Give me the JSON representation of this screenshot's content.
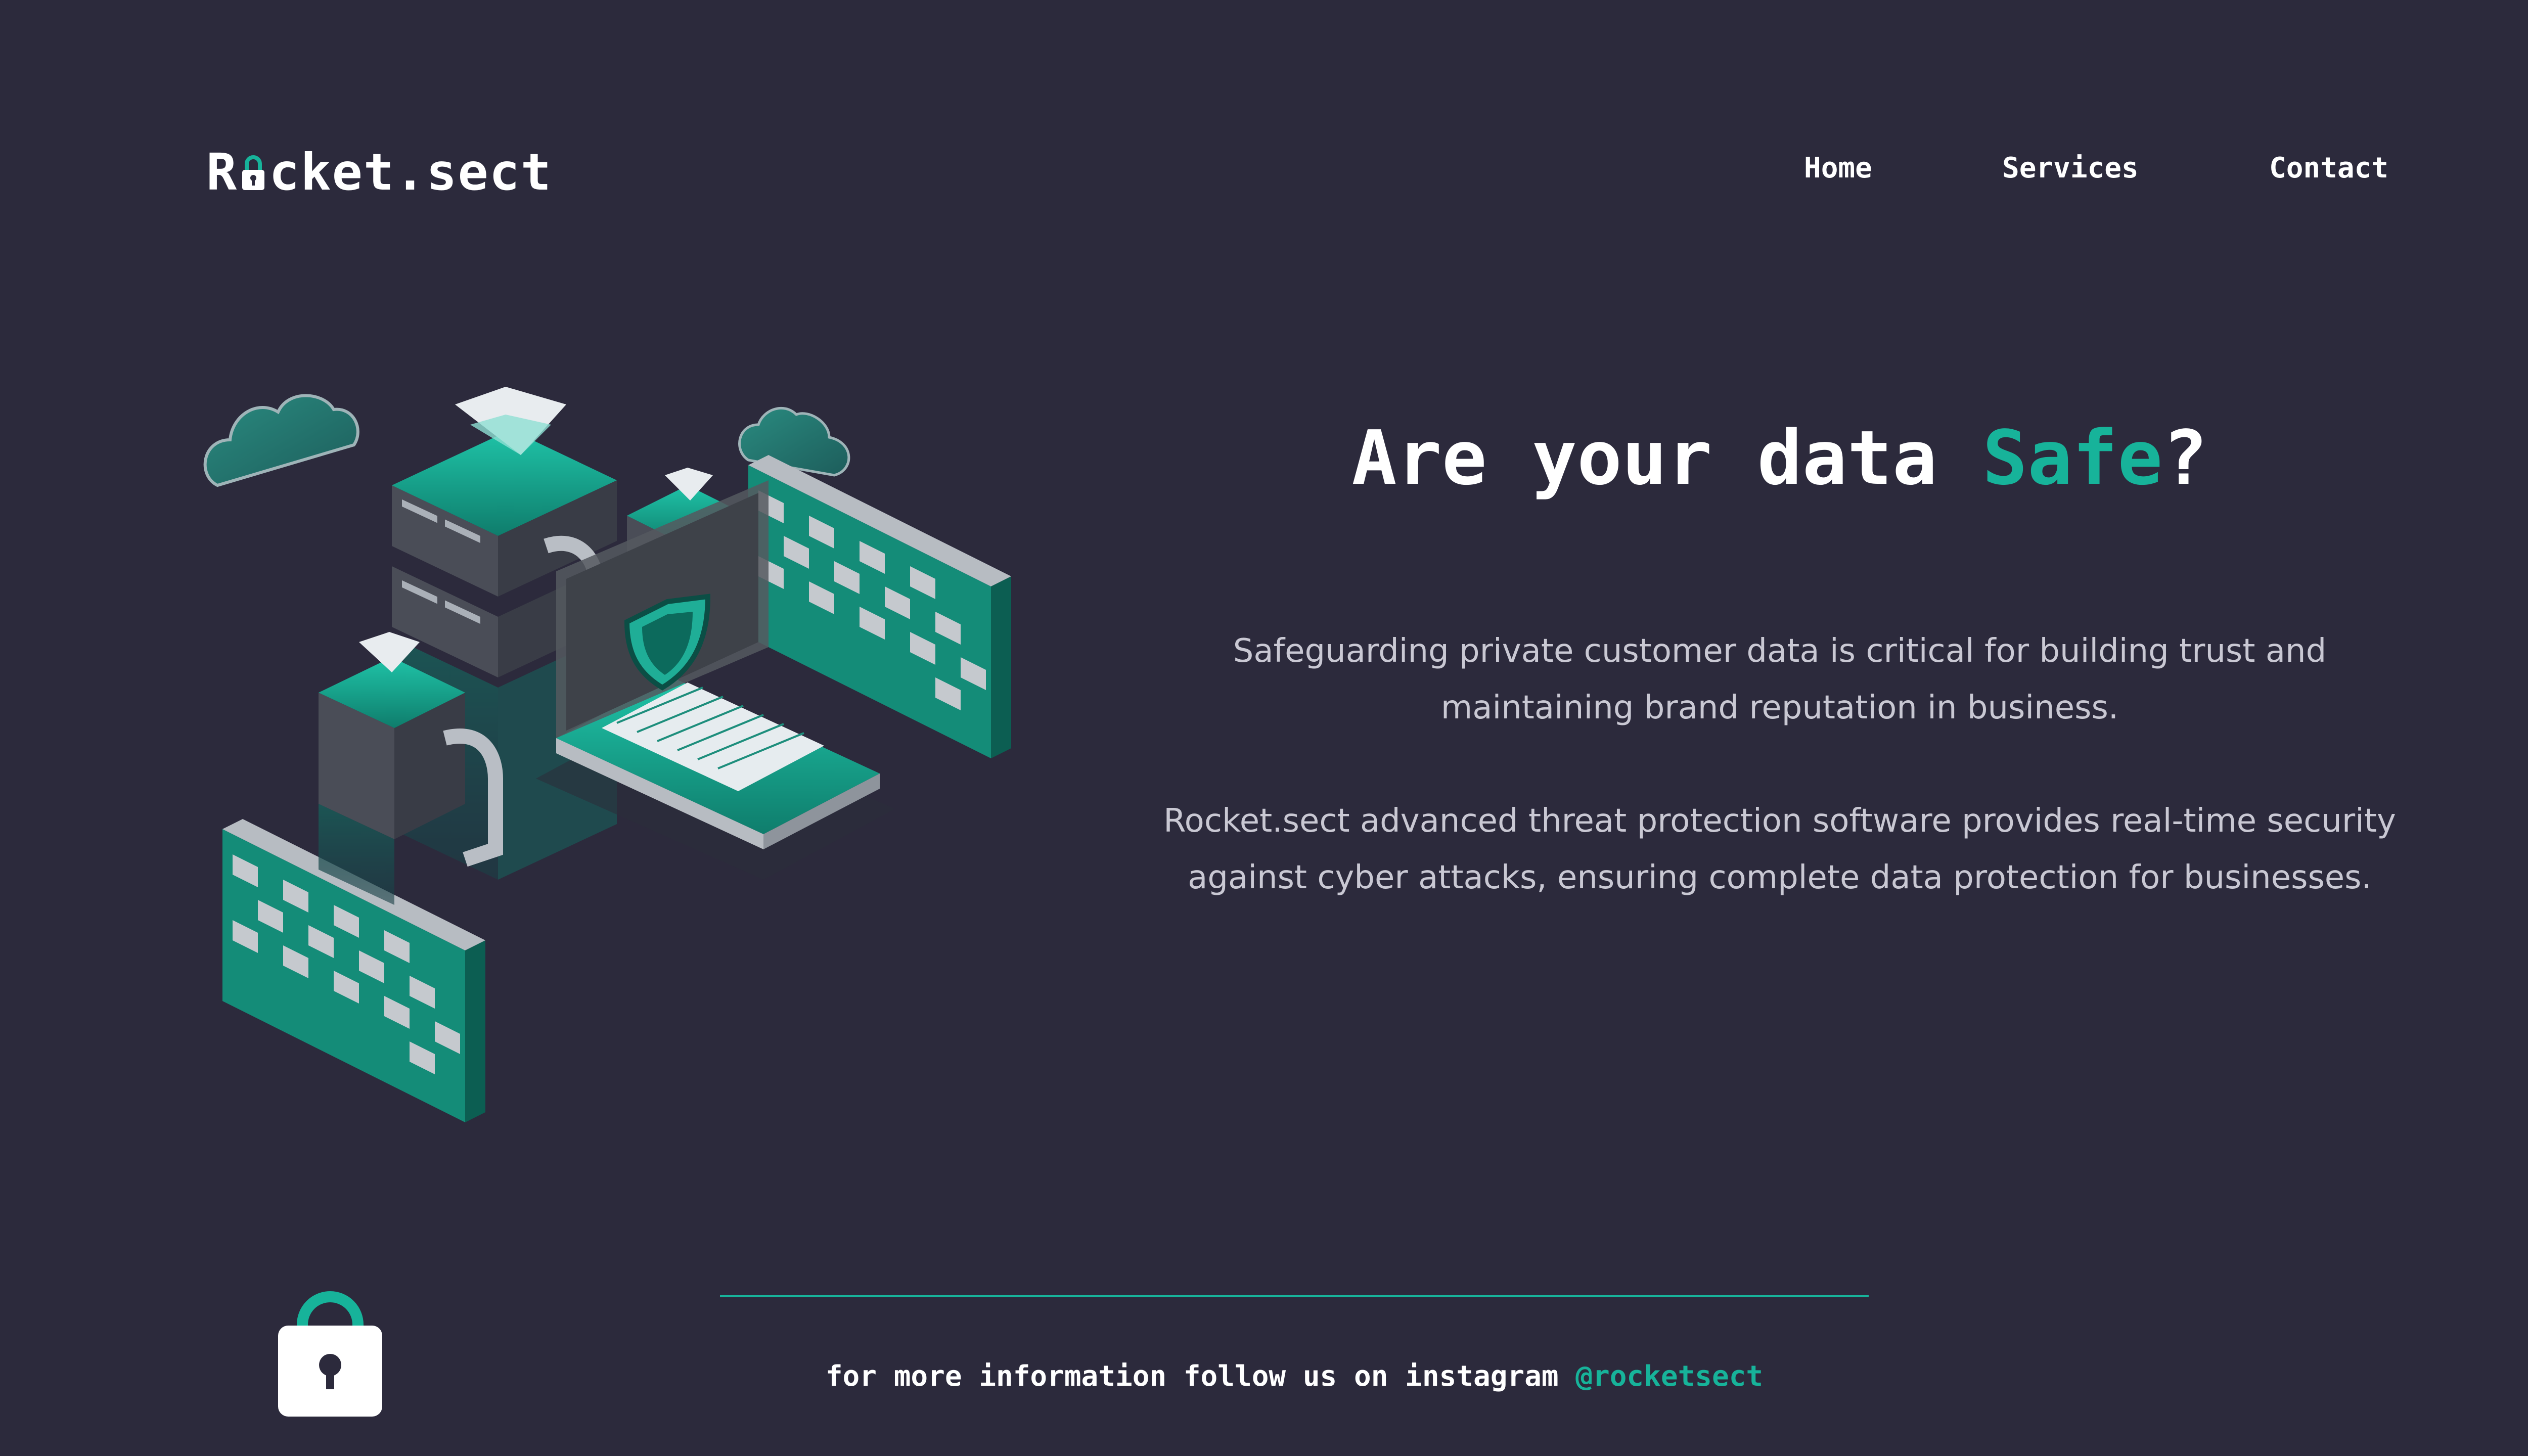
{
  "brand": {
    "name_prefix": "R",
    "name_suffix": "cket.sect",
    "logo_icon": "padlock-icon"
  },
  "nav": {
    "items": [
      {
        "label": "Home"
      },
      {
        "label": "Services"
      },
      {
        "label": "Contact"
      }
    ]
  },
  "hero": {
    "title_before": "Are your data ",
    "title_accent": "Safe",
    "title_after": "?",
    "paragraphs": [
      "Safeguarding private customer data is critical for building trust and maintaining brand reputation in business.",
      "Rocket.sect advanced threat protection software provides real-time security against cyber attacks, ensuring complete data protection for businesses."
    ],
    "illustration_icon": "isometric-data-security-illustration"
  },
  "footer": {
    "text": "for more information follow us on instagram ",
    "handle": "@rocketsect",
    "lock_icon": "padlock-icon"
  },
  "colors": {
    "background": "#2c2a3c",
    "accent": "#17b39a",
    "text": "#ffffff",
    "muted_text": "#c9c8d3"
  }
}
